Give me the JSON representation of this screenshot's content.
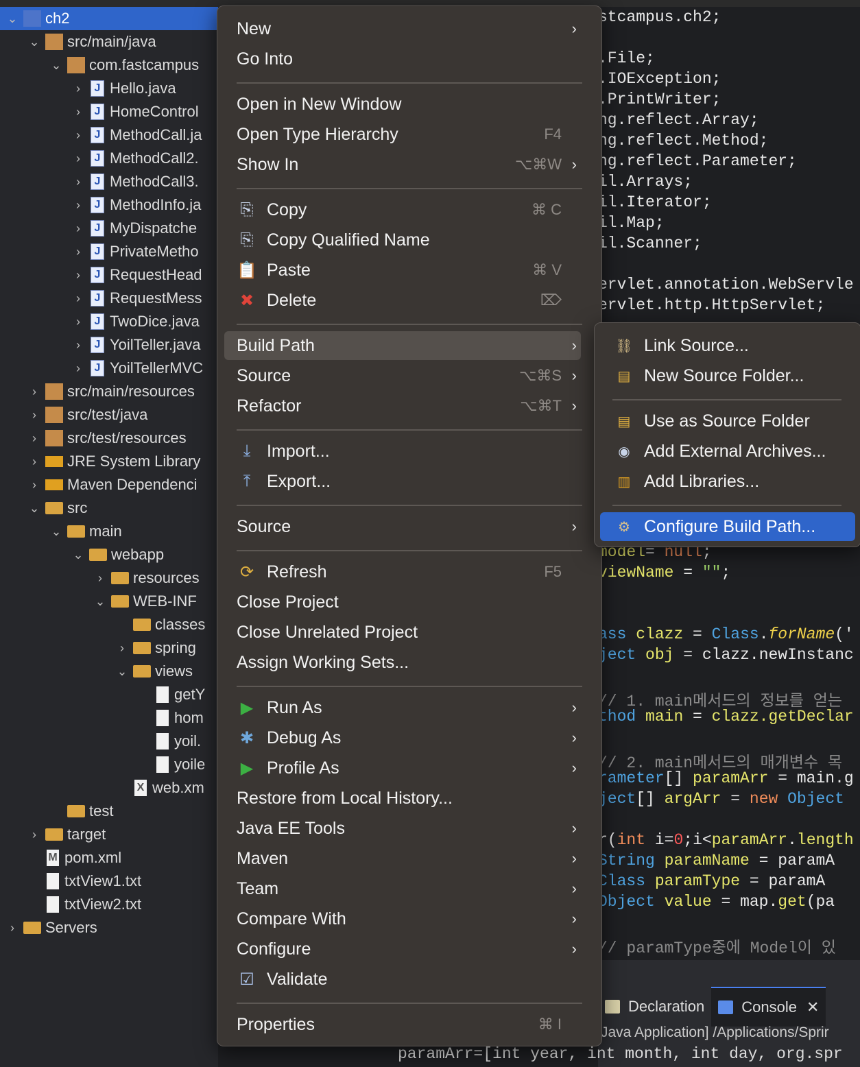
{
  "explorer": {
    "rows": [
      {
        "label": "ch2",
        "depth": 0,
        "chev": "⌄",
        "icon": "project-icon",
        "selected": true
      },
      {
        "label": "src/main/java",
        "depth": 1,
        "chev": "⌄",
        "icon": "source-folder-icon"
      },
      {
        "label": "com.fastcampus",
        "depth": 2,
        "chev": "⌄",
        "icon": "package-icon"
      },
      {
        "label": "Hello.java",
        "depth": 3,
        "chev": "›",
        "icon": "java-file-icon"
      },
      {
        "label": "HomeControl",
        "depth": 3,
        "chev": "›",
        "icon": "java-file-icon"
      },
      {
        "label": "MethodCall.ja",
        "depth": 3,
        "chev": "›",
        "icon": "java-file-icon"
      },
      {
        "label": "MethodCall2.",
        "depth": 3,
        "chev": "›",
        "icon": "java-file-icon"
      },
      {
        "label": "MethodCall3.",
        "depth": 3,
        "chev": "›",
        "icon": "java-file-icon"
      },
      {
        "label": "MethodInfo.ja",
        "depth": 3,
        "chev": "›",
        "icon": "java-file-icon"
      },
      {
        "label": "MyDispatche",
        "depth": 3,
        "chev": "›",
        "icon": "java-file-icon"
      },
      {
        "label": "PrivateMetho",
        "depth": 3,
        "chev": "›",
        "icon": "java-file-icon"
      },
      {
        "label": "RequestHead",
        "depth": 3,
        "chev": "›",
        "icon": "java-file-icon"
      },
      {
        "label": "RequestMess",
        "depth": 3,
        "chev": "›",
        "icon": "java-file-icon"
      },
      {
        "label": "TwoDice.java",
        "depth": 3,
        "chev": "›",
        "icon": "java-file-icon"
      },
      {
        "label": "YoilTeller.java",
        "depth": 3,
        "chev": "›",
        "icon": "java-file-icon"
      },
      {
        "label": "YoilTellerMVC",
        "depth": 3,
        "chev": "›",
        "icon": "java-file-icon"
      },
      {
        "label": "src/main/resources",
        "depth": 1,
        "chev": "›",
        "icon": "source-folder-icon"
      },
      {
        "label": "src/test/java",
        "depth": 1,
        "chev": "›",
        "icon": "source-folder-icon"
      },
      {
        "label": "src/test/resources",
        "depth": 1,
        "chev": "›",
        "icon": "source-folder-icon"
      },
      {
        "label": "JRE System Library",
        "depth": 1,
        "chev": "›",
        "icon": "library-icon"
      },
      {
        "label": "Maven Dependenci",
        "depth": 1,
        "chev": "›",
        "icon": "library-icon"
      },
      {
        "label": "src",
        "depth": 1,
        "chev": "⌄",
        "icon": "folder-icon"
      },
      {
        "label": "main",
        "depth": 2,
        "chev": "⌄",
        "icon": "folder-icon"
      },
      {
        "label": "webapp",
        "depth": 3,
        "chev": "⌄",
        "icon": "folder-icon"
      },
      {
        "label": "resources",
        "depth": 4,
        "chev": "›",
        "icon": "folder-icon"
      },
      {
        "label": "WEB-INF",
        "depth": 4,
        "chev": "⌄",
        "icon": "folder-icon"
      },
      {
        "label": "classes",
        "depth": 5,
        "chev": "",
        "icon": "folder-icon"
      },
      {
        "label": "spring",
        "depth": 5,
        "chev": "›",
        "icon": "folder-icon"
      },
      {
        "label": "views",
        "depth": 5,
        "chev": "⌄",
        "icon": "folder-icon"
      },
      {
        "label": "getY",
        "depth": 6,
        "chev": "",
        "icon": "file-icon"
      },
      {
        "label": "hom",
        "depth": 6,
        "chev": "",
        "icon": "file-icon"
      },
      {
        "label": "yoil.",
        "depth": 6,
        "chev": "",
        "icon": "file-icon"
      },
      {
        "label": "yoile",
        "depth": 6,
        "chev": "",
        "icon": "file-icon"
      },
      {
        "label": "web.xm",
        "depth": 5,
        "chev": "",
        "icon": "xml-file-icon"
      },
      {
        "label": "test",
        "depth": 2,
        "chev": "",
        "icon": "folder-icon"
      },
      {
        "label": "target",
        "depth": 1,
        "chev": "›",
        "icon": "folder-icon"
      },
      {
        "label": "pom.xml",
        "depth": 1,
        "chev": "",
        "icon": "maven-file-icon"
      },
      {
        "label": "txtView1.txt",
        "depth": 1,
        "chev": "",
        "icon": "file-icon"
      },
      {
        "label": "txtView2.txt",
        "depth": 1,
        "chev": "",
        "icon": "file-icon"
      },
      {
        "label": "Servers",
        "depth": 0,
        "chev": "›",
        "icon": "folder-icon"
      }
    ]
  },
  "menu": {
    "items": [
      {
        "name": "new",
        "label": "New",
        "shortcut": "",
        "submenu": true,
        "icon": ""
      },
      {
        "name": "go-into",
        "label": "Go Into",
        "shortcut": "",
        "submenu": false,
        "icon": ""
      },
      {
        "sep": true
      },
      {
        "name": "open-in-new-window",
        "label": "Open in New Window",
        "shortcut": "",
        "submenu": false,
        "icon": ""
      },
      {
        "name": "open-type-hierarchy",
        "label": "Open Type Hierarchy",
        "shortcut": "F4",
        "submenu": false,
        "icon": ""
      },
      {
        "name": "show-in",
        "label": "Show In",
        "shortcut": "⌥⌘W",
        "submenu": true,
        "icon": ""
      },
      {
        "sep": true
      },
      {
        "name": "copy",
        "label": "Copy",
        "shortcut": "⌘ C",
        "submenu": false,
        "icon": "copy-icon"
      },
      {
        "name": "copy-qualified-name",
        "label": "Copy Qualified Name",
        "shortcut": "",
        "submenu": false,
        "icon": "copy-qualified-icon"
      },
      {
        "name": "paste",
        "label": "Paste",
        "shortcut": "⌘ V",
        "submenu": false,
        "icon": "paste-icon"
      },
      {
        "name": "delete",
        "label": "Delete",
        "shortcut": "⌦",
        "submenu": false,
        "icon": "delete-icon"
      },
      {
        "sep": true
      },
      {
        "name": "build-path",
        "label": "Build Path",
        "shortcut": "",
        "submenu": true,
        "icon": "",
        "highlighted": true
      },
      {
        "name": "source",
        "label": "Source",
        "shortcut": "⌥⌘S",
        "submenu": true,
        "icon": ""
      },
      {
        "name": "refactor",
        "label": "Refactor",
        "shortcut": "⌥⌘T",
        "submenu": true,
        "icon": ""
      },
      {
        "sep": true
      },
      {
        "name": "import",
        "label": "Import...",
        "shortcut": "",
        "submenu": false,
        "icon": "import-icon"
      },
      {
        "name": "export",
        "label": "Export...",
        "shortcut": "",
        "submenu": false,
        "icon": "export-icon"
      },
      {
        "sep": true
      },
      {
        "name": "source-2",
        "label": "Source",
        "shortcut": "",
        "submenu": true,
        "icon": ""
      },
      {
        "sep": true
      },
      {
        "name": "refresh",
        "label": "Refresh",
        "shortcut": "F5",
        "submenu": false,
        "icon": "refresh-icon"
      },
      {
        "name": "close-project",
        "label": "Close Project",
        "shortcut": "",
        "submenu": false,
        "icon": ""
      },
      {
        "name": "close-unrelated-project",
        "label": "Close Unrelated Project",
        "shortcut": "",
        "submenu": false,
        "icon": ""
      },
      {
        "name": "assign-working-sets",
        "label": "Assign Working Sets...",
        "shortcut": "",
        "submenu": false,
        "icon": ""
      },
      {
        "sep": true
      },
      {
        "name": "run-as",
        "label": "Run As",
        "shortcut": "",
        "submenu": true,
        "icon": "run-icon"
      },
      {
        "name": "debug-as",
        "label": "Debug As",
        "shortcut": "",
        "submenu": true,
        "icon": "debug-icon"
      },
      {
        "name": "profile-as",
        "label": "Profile As",
        "shortcut": "",
        "submenu": true,
        "icon": "profile-icon"
      },
      {
        "name": "restore-from-local-history",
        "label": "Restore from Local History...",
        "shortcut": "",
        "submenu": false,
        "icon": ""
      },
      {
        "name": "java-ee-tools",
        "label": "Java EE Tools",
        "shortcut": "",
        "submenu": true,
        "icon": ""
      },
      {
        "name": "maven",
        "label": "Maven",
        "shortcut": "",
        "submenu": true,
        "icon": ""
      },
      {
        "name": "team",
        "label": "Team",
        "shortcut": "",
        "submenu": true,
        "icon": ""
      },
      {
        "name": "compare-with",
        "label": "Compare With",
        "shortcut": "",
        "submenu": true,
        "icon": ""
      },
      {
        "name": "configure",
        "label": "Configure",
        "shortcut": "",
        "submenu": true,
        "icon": ""
      },
      {
        "name": "validate",
        "label": "Validate",
        "shortcut": "",
        "submenu": false,
        "icon": "checkbox-checked-icon"
      },
      {
        "sep": true
      },
      {
        "name": "properties",
        "label": "Properties",
        "shortcut": "⌘ I",
        "submenu": false,
        "icon": ""
      }
    ]
  },
  "submenu": {
    "items": [
      {
        "name": "link-source",
        "label": "Link Source...",
        "icon": "link-source-icon"
      },
      {
        "name": "new-source-folder",
        "label": "New Source Folder...",
        "icon": "new-source-folder-icon"
      },
      {
        "sep": true
      },
      {
        "name": "use-as-source-folder",
        "label": "Use as Source Folder",
        "icon": "source-folder-icon"
      },
      {
        "name": "add-external-archives",
        "label": "Add External Archives...",
        "icon": "jar-icon"
      },
      {
        "name": "add-libraries",
        "label": "Add Libraries...",
        "icon": "library-icon"
      },
      {
        "sep": true
      },
      {
        "name": "configure-build-path",
        "label": "Configure Build Path...",
        "icon": "configure-build-path-icon",
        "active": true
      }
    ]
  },
  "editor": {
    "lines": [
      [
        [
          "",
          "stcampus.ch2;"
        ]
      ],
      [
        [
          "",
          ".File;"
        ]
      ],
      [
        [
          "",
          ".IOException;"
        ]
      ],
      [
        [
          "",
          ".PrintWriter;"
        ]
      ],
      [
        [
          "",
          "ng.reflect.Array;"
        ]
      ],
      [
        [
          "",
          "ng.reflect.Method;"
        ]
      ],
      [
        [
          "",
          "ng.reflect.Parameter;"
        ]
      ],
      [
        [
          "",
          "il.Arrays;"
        ]
      ],
      [
        [
          "",
          "il.Iterator;"
        ]
      ],
      [
        [
          "",
          "il.Map;"
        ]
      ],
      [
        [
          "",
          "il.Scanner;"
        ]
      ],
      [
        [
          "",
          "ervlet.annotation.WebServle"
        ]
      ],
      [
        [
          "",
          "ervlet.http.HttpServlet;"
        ]
      ],
      [
        [
          "vr",
          "model"
        ],
        [
          "",
          "",
          " "
        ],
        [
          "",
          "= "
        ],
        [
          "kw",
          "null"
        ],
        [
          "",
          ";"
        ]
      ],
      [
        [
          "vr",
          "viewName"
        ],
        [
          "",
          " = "
        ],
        [
          "st",
          "\"\""
        ],
        [
          "",
          ";"
        ]
      ],
      [
        [
          "ty",
          "ass"
        ],
        [
          "",
          " "
        ],
        [
          "vr",
          "clazz"
        ],
        [
          "",
          " = "
        ],
        [
          "ty",
          "Class"
        ],
        [
          "",
          "."
        ],
        [
          "fn",
          "forName"
        ],
        [
          "",
          "('"
        ]
      ],
      [
        [
          "ty",
          "ject"
        ],
        [
          "",
          " "
        ],
        [
          "vr",
          "obj"
        ],
        [
          "",
          " = clazz."
        ],
        [
          "",
          "newInstanc"
        ]
      ],
      [
        [
          "cm",
          "  // 1. main메서드의 정보를 얻는"
        ]
      ],
      [
        [
          "ty",
          "thod"
        ],
        [
          "",
          " "
        ],
        [
          "vr",
          "main"
        ],
        [
          "",
          " = "
        ],
        [
          "vr",
          "clazz.getDeclar"
        ]
      ],
      [
        [
          "cm",
          "  // 2. main메서드의 매개변수 목"
        ]
      ],
      [
        [
          "ty",
          "rameter"
        ],
        [
          "",
          "[] "
        ],
        [
          "vr",
          "paramArr"
        ],
        [
          "",
          " = main.g"
        ]
      ],
      [
        [
          "ty",
          "ject"
        ],
        [
          "",
          "[] "
        ],
        [
          "vr",
          "argArr"
        ],
        [
          "",
          " = "
        ],
        [
          "kw",
          "new"
        ],
        [
          "",
          " "
        ],
        [
          "ty",
          "Object"
        ]
      ],
      [
        [
          "",
          "r("
        ],
        [
          "kw",
          "int"
        ],
        [
          "",
          " i="
        ],
        [
          "nl",
          "0"
        ],
        [
          "",
          ";i<"
        ],
        [
          "vr",
          "paramArr"
        ],
        [
          "",
          "."
        ],
        [
          "vr",
          "length"
        ]
      ],
      [
        [
          "ty",
          "  String"
        ],
        [
          "",
          " "
        ],
        [
          "vr",
          "paramName"
        ],
        [
          "",
          " = paramA"
        ]
      ],
      [
        [
          "ty",
          "  Class"
        ],
        [
          "",
          "  "
        ],
        [
          "vr",
          "paramType"
        ],
        [
          "",
          " = paramA"
        ]
      ],
      [
        [
          "ty",
          "  Object"
        ],
        [
          "",
          " "
        ],
        [
          "vr",
          "value"
        ],
        [
          "",
          " = map."
        ],
        [
          "vr",
          "get"
        ],
        [
          "",
          "(pa"
        ]
      ],
      [
        [
          "cm",
          "  // paramType중에 Model이 있"
        ]
      ]
    ]
  },
  "panel": {
    "tab_declaration": "Declaration",
    "tab_console": "Console",
    "close_glyph": "✕",
    "console_header": "Java Application] /Applications/Sprir",
    "console_output": "paramArr=[int year, int month, int day, org.spr"
  }
}
